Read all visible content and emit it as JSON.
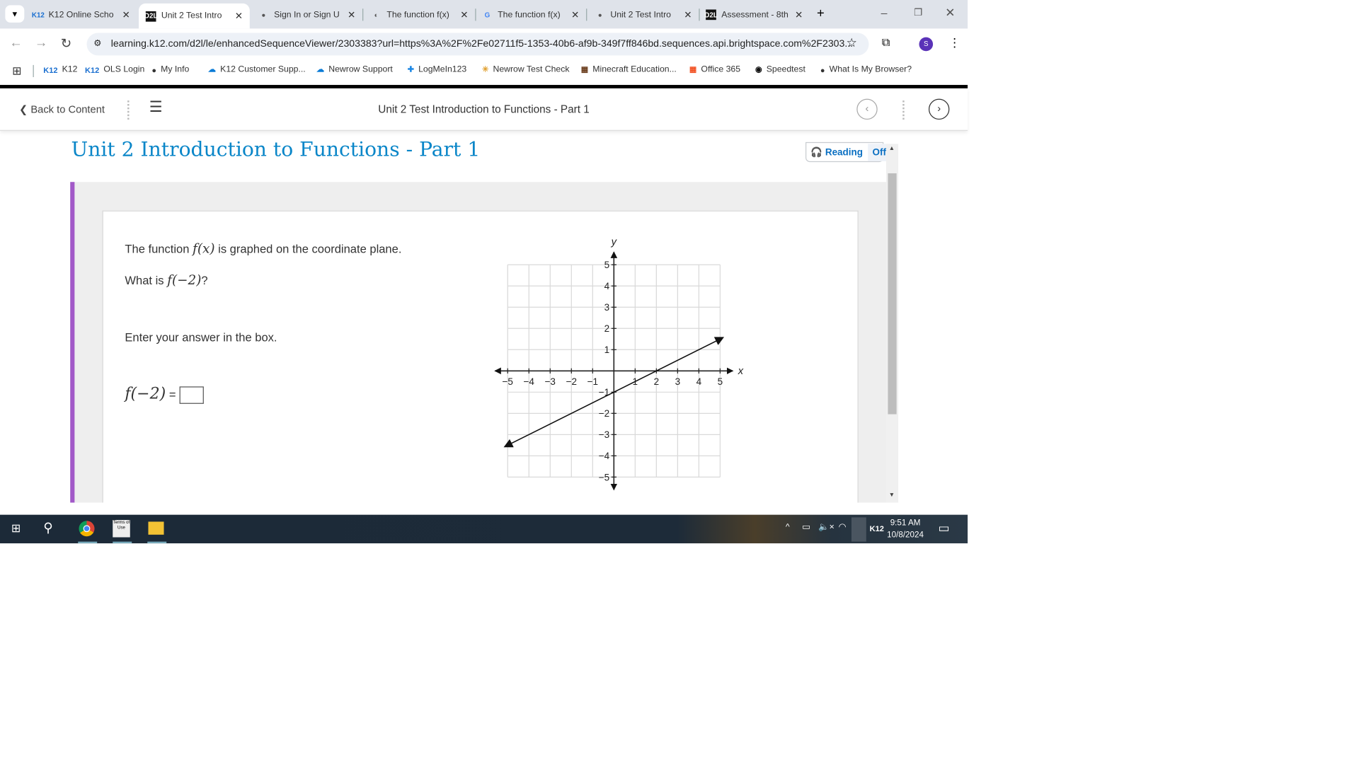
{
  "browser": {
    "tabs": [
      {
        "label": "K12 Online Scho",
        "icon": "K12"
      },
      {
        "label": "Unit 2 Test Intro",
        "icon": "D2L",
        "active": true
      },
      {
        "label": "Sign In or Sign U",
        "icon": "globe"
      },
      {
        "label": "The function f(x)",
        "icon": "loading"
      },
      {
        "label": "The function f(x)",
        "icon": "G"
      },
      {
        "label": "Unit 2 Test Intro",
        "icon": "globe"
      },
      {
        "label": "Assessment - 8th",
        "icon": "D2L"
      }
    ],
    "url": "learning.k12.com/d2l/le/enhancedSequenceViewer/2303383?url=https%3A%2F%2Fe02711f5-1353-40b6-af9b-349f7ff846bd.sequences.api.brightspace.com%2F2303...",
    "profile_initial": "S",
    "bookmarks": [
      {
        "label": "K12",
        "icon": "K12"
      },
      {
        "label": "OLS Login",
        "icon": "K12"
      },
      {
        "label": "My Info",
        "icon": "globe"
      },
      {
        "label": "K12 Customer Supp...",
        "icon": "cloud"
      },
      {
        "label": "Newrow Support",
        "icon": "cloud"
      },
      {
        "label": "LogMeIn123",
        "icon": "plus"
      },
      {
        "label": "Newrow Test Check",
        "icon": "spark"
      },
      {
        "label": "Minecraft Education...",
        "icon": "minecraft"
      },
      {
        "label": "Office 365",
        "icon": "windows"
      },
      {
        "label": "Speedtest",
        "icon": "gauge"
      },
      {
        "label": "What Is My Browser?",
        "icon": "globe"
      }
    ]
  },
  "header": {
    "back_label": "Back to Content",
    "title": "Unit 2 Test Introduction to Functions - Part 1"
  },
  "page": {
    "title": "Unit 2 Introduction to Functions - Part 1",
    "reading_label": "Reading",
    "reading_state": "Off",
    "accent": "#a259c8",
    "q1a": "The function",
    "q1m": "f(x)",
    "q1b": "is graphed on the coordinate plane.",
    "q2a": "What is",
    "q2m": "f(−2)",
    "q2b": "?",
    "q3": "Enter your answer in the box.",
    "ans_m": "f(−2)",
    "ans_eq": "=",
    "answer_value": ""
  },
  "chart_data": {
    "type": "line",
    "xlabel": "x",
    "ylabel": "y",
    "xlim": [
      -5,
      5
    ],
    "ylim": [
      -5,
      5
    ],
    "grid": true,
    "xticks": [
      "−5",
      "−4",
      "−3",
      "−2",
      "−1",
      "1",
      "2",
      "3",
      "4",
      "5"
    ],
    "yticks": [
      "5",
      "4",
      "3",
      "2",
      "1",
      "−1",
      "−2",
      "−3",
      "−4",
      "−5"
    ],
    "series": [
      {
        "points": [
          [
            -5,
            -3.5
          ],
          [
            5,
            1.5
          ]
        ],
        "arrows": "both"
      }
    ]
  },
  "taskbar": {
    "time": "9:51 AM",
    "date": "10/8/2024",
    "tray_label": "K12"
  }
}
